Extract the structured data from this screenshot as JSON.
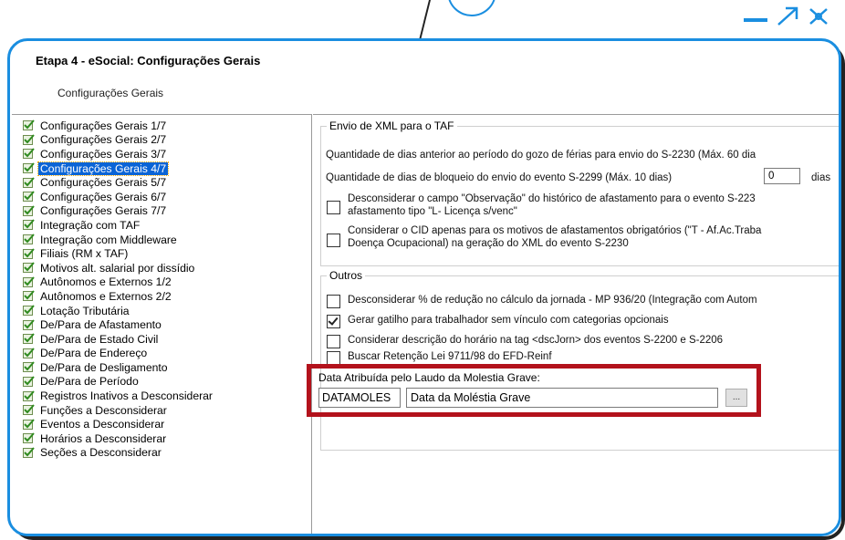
{
  "window": {
    "title": "Etapa 4 - eSocial: Configurações Gerais",
    "subtitle": "Configurações Gerais"
  },
  "tree": {
    "items": [
      {
        "label": "Configurações Gerais 1/7"
      },
      {
        "label": "Configurações Gerais 2/7"
      },
      {
        "label": "Configurações Gerais 3/7"
      },
      {
        "label": "Configurações Gerais 4/7",
        "selected": true
      },
      {
        "label": "Configurações Gerais 5/7"
      },
      {
        "label": "Configurações Gerais 6/7"
      },
      {
        "label": "Configurações Gerais 7/7"
      },
      {
        "label": "Integração com TAF"
      },
      {
        "label": "Integração com Middleware"
      },
      {
        "label": "Filiais (RM x TAF)"
      },
      {
        "label": "Motivos alt. salarial por dissídio"
      },
      {
        "label": "Autônomos e Externos 1/2"
      },
      {
        "label": "Autônomos e Externos 2/2"
      },
      {
        "label": "Lotação Tributária"
      },
      {
        "label": "De/Para de Afastamento"
      },
      {
        "label": "De/Para de Estado Civil"
      },
      {
        "label": "De/Para de Endereço"
      },
      {
        "label": "De/Para de Desligamento"
      },
      {
        "label": "De/Para de Período"
      },
      {
        "label": "Registros Inativos a Desconsiderar"
      },
      {
        "label": "Funções a Desconsiderar"
      },
      {
        "label": "Eventos a Desconsiderar"
      },
      {
        "label": "Horários a Desconsiderar"
      },
      {
        "label": "Seções a Desconsiderar"
      }
    ]
  },
  "envio": {
    "group_title": "Envio de XML para o TAF",
    "dias_ferias_label": "Quantidade de dias anterior ao período do gozo de férias para envio do S-2230 (Máx. 60 dia",
    "dias_bloqueio_label": "Quantidade de dias de bloqueio do envio do evento S-2299 (Máx. 10 dias)",
    "dias_bloqueio_value": "0",
    "dias_suffix": "dias",
    "obs_line1": "Desconsiderar o campo \"Observação\" do histórico de afastamento para o evento S-223",
    "obs_line2": "afastamento tipo \"L- Licença s/venc\"",
    "cid_line1": "Considerar o CID apenas para os motivos de afastamentos obrigatórios (\"T - Af.Ac.Traba",
    "cid_line2": "Doença Ocupacional) na geração do XML do evento S-2230"
  },
  "outros": {
    "group_title": "Outros",
    "opt1": "Desconsiderar % de redução no cálculo da jornada - MP 936/20 (Integração com Autom",
    "opt2": "Gerar gatilho para trabalhador sem vínculo com categorias opcionais",
    "opt2_checked": true,
    "opt3": "Considerar descrição do horário na tag <dscJorn> dos eventos S-2200 e S-2206",
    "opt4": "Buscar Retenção Lei 9711/98 do EFD-Reinf"
  },
  "molestia": {
    "label": "Data Atribuída pelo Laudo da Molestia Grave:",
    "code": "DATAMOLES",
    "description": "Data da Moléstia Grave",
    "button": "..."
  },
  "colors": {
    "frame": "#1a8ee0",
    "highlight": "#b3121c",
    "selection": "#0a64d6"
  }
}
